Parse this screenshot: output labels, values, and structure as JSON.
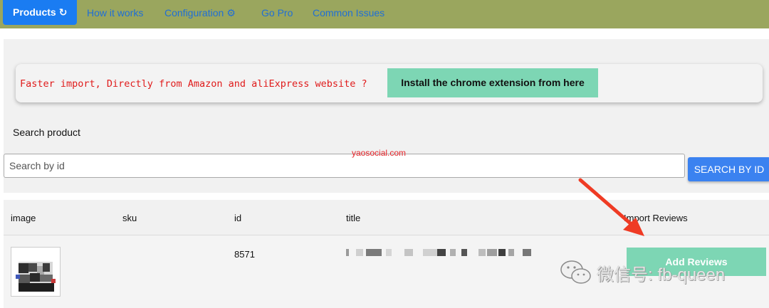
{
  "navbar": {
    "active_tab": "Products",
    "tabs": [
      "How it works",
      "Configuration",
      "Go Pro",
      "Common Issues"
    ],
    "active_icon": "refresh-icon",
    "configuration_icon": "cogs-icon",
    "background_color": "#9aa65e",
    "active_color": "#1a7cf2"
  },
  "promo": {
    "text": "Faster import, Directly from Amazon and aliExpress website ?",
    "button_label": "Install the chrome extension from here",
    "button_color": "#7dd6b4"
  },
  "search": {
    "label": "Search product",
    "placeholder": "Search by id",
    "value": "",
    "button_label": "SEARCH BY ID"
  },
  "watermarks": {
    "site": "yaosocial.com",
    "wechat": "微信号: fb-queen"
  },
  "table": {
    "columns": [
      "image",
      "sku",
      "id",
      "title",
      "Import Reviews"
    ],
    "rows": [
      {
        "sku": "",
        "id": "8571",
        "action_label": "Add Reviews"
      }
    ]
  }
}
